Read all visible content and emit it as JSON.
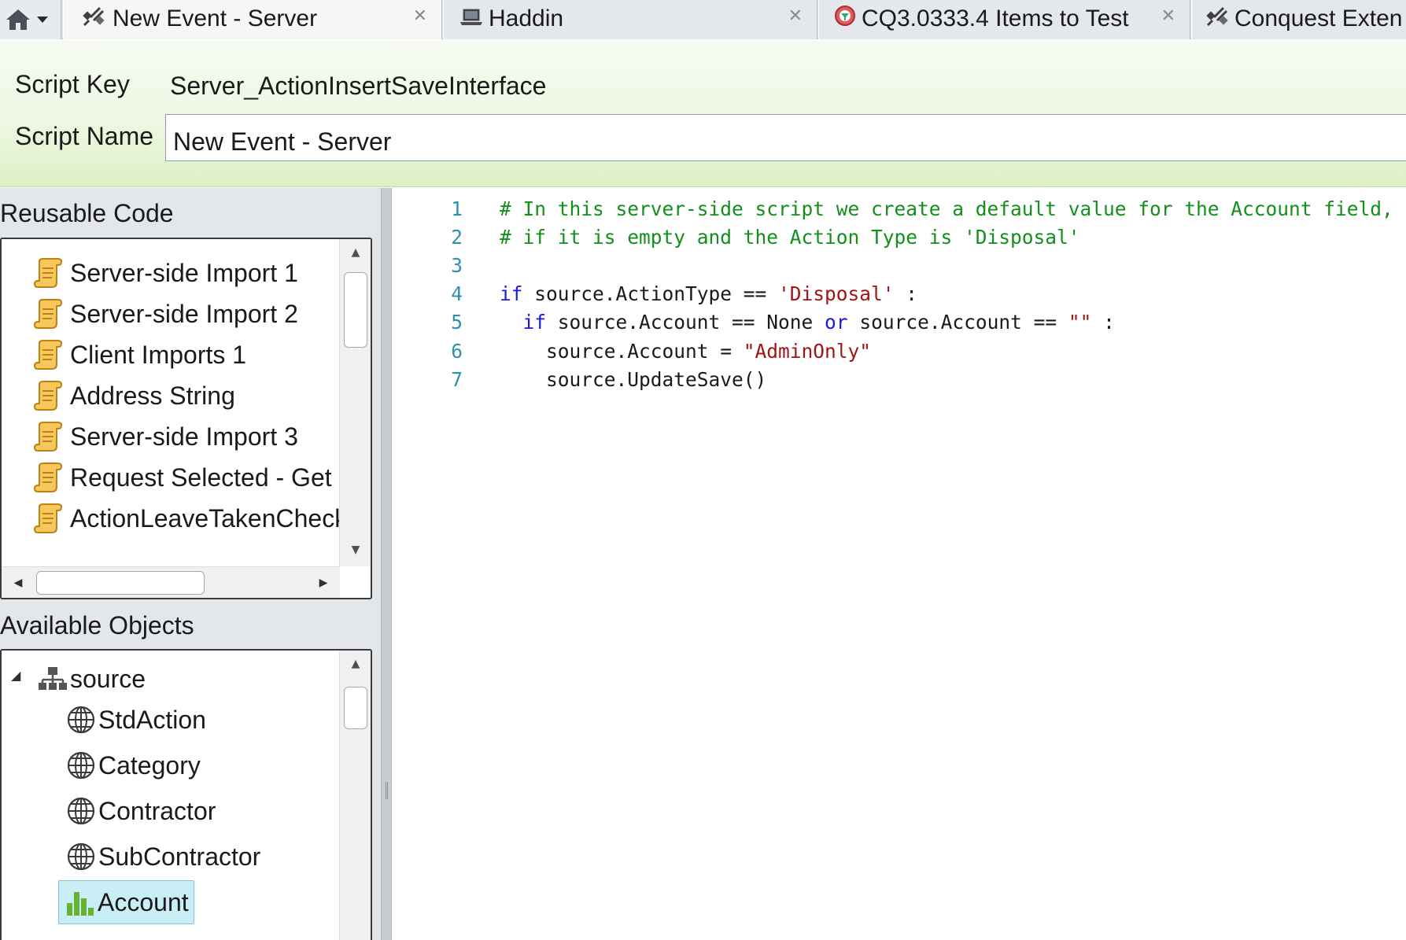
{
  "tabs": [
    {
      "label": "New Event - Server",
      "icon": "wrench-satellite-icon",
      "closable": true,
      "active": true
    },
    {
      "label": "Haddin",
      "icon": "laptop-icon",
      "closable": true,
      "active": false
    },
    {
      "label": "CQ3.0333.4 Items to Test",
      "icon": "query-icon",
      "closable": true,
      "active": false
    },
    {
      "label": "Conquest Exten",
      "icon": "wrench-satellite-icon",
      "closable": false,
      "active": false
    }
  ],
  "home": {
    "icon": "home-icon",
    "dropdown_icon": "chevron-down-icon"
  },
  "header": {
    "script_key_label": "Script Key",
    "script_key_value": "Server_ActionInsertSaveInterface",
    "script_name_label": "Script Name",
    "script_name_value": "New Event - Server"
  },
  "reusable_code": {
    "title": "Reusable Code",
    "items": [
      "Server-side Import 1",
      "Server-side Import 2",
      "Client Imports 1",
      "Address String",
      "Server-side Import 3",
      "Request Selected - Get C",
      "ActionLeaveTakenCheck("
    ],
    "item_icon": "scroll-icon"
  },
  "available_objects": {
    "title": "Available Objects",
    "root": {
      "label": "source",
      "icon": "hierarchy-icon",
      "expanded": true
    },
    "children": [
      {
        "label": "StdAction",
        "icon": "globe-icon",
        "selected": false
      },
      {
        "label": "Category",
        "icon": "globe-icon",
        "selected": false
      },
      {
        "label": "Contractor",
        "icon": "globe-icon",
        "selected": false
      },
      {
        "label": "SubContractor",
        "icon": "globe-icon",
        "selected": false
      },
      {
        "label": "Account",
        "icon": "bar-chart-icon",
        "selected": true
      }
    ]
  },
  "editor": {
    "lines": [
      {
        "num": "1",
        "tokens": [
          {
            "t": "# In this server-side script we create a default value for the Account field,",
            "c": "comment"
          }
        ]
      },
      {
        "num": "2",
        "tokens": [
          {
            "t": "# if it is empty and the Action Type is 'Disposal'",
            "c": "comment"
          }
        ]
      },
      {
        "num": "3",
        "tokens": []
      },
      {
        "num": "4",
        "tokens": [
          {
            "t": "if",
            "c": "keyword"
          },
          {
            "t": " source.ActionType == ",
            "c": "plain"
          },
          {
            "t": "'Disposal'",
            "c": "string"
          },
          {
            "t": " :",
            "c": "plain"
          }
        ]
      },
      {
        "num": "5",
        "tokens": [
          {
            "t": "  ",
            "c": "plain"
          },
          {
            "t": "if",
            "c": "keyword"
          },
          {
            "t": " source.Account == None ",
            "c": "plain"
          },
          {
            "t": "or",
            "c": "keyword"
          },
          {
            "t": " source.Account == ",
            "c": "plain"
          },
          {
            "t": "\"\"",
            "c": "string"
          },
          {
            "t": " :",
            "c": "plain"
          }
        ]
      },
      {
        "num": "6",
        "tokens": [
          {
            "t": "    source.Account = ",
            "c": "plain"
          },
          {
            "t": "\"AdminOnly\"",
            "c": "string"
          }
        ]
      },
      {
        "num": "7",
        "tokens": [
          {
            "t": "    source.UpdateSave()",
            "c": "plain"
          }
        ]
      }
    ]
  },
  "colors": {
    "comment": "#12901b",
    "keyword": "#1a1ae0",
    "string": "#a31515",
    "line_number": "#2b91af",
    "header_green": "#ddf0c4",
    "selection": "#c9eef6"
  }
}
